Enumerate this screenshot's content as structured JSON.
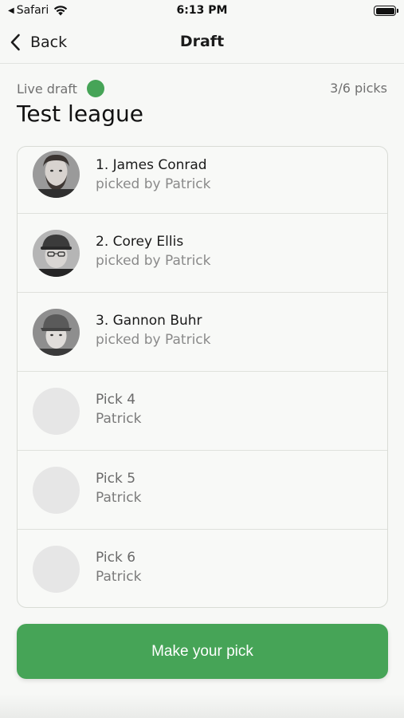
{
  "status_bar": {
    "back_app": "Safari",
    "time": "6:13 PM",
    "icons": [
      "back-triangle-icon",
      "wifi-icon",
      "battery-icon"
    ]
  },
  "nav": {
    "back_label": "Back",
    "title": "Draft"
  },
  "header": {
    "live_label": "Live draft",
    "live_color": "#46a457",
    "pick_count": "3/6 picks",
    "league_name": "Test league"
  },
  "picks": [
    {
      "name": "1. James Conrad",
      "sub": "picked by Patrick",
      "avatar": "player-photo"
    },
    {
      "name": "2. Corey Ellis",
      "sub": "picked by Patrick",
      "avatar": "player-photo"
    },
    {
      "name": "3. Gannon Buhr",
      "sub": "picked by Patrick",
      "avatar": "player-photo"
    },
    {
      "name": "Pick 4",
      "sub": "Patrick",
      "avatar": "empty"
    },
    {
      "name": "Pick 5",
      "sub": "Patrick",
      "avatar": "empty"
    },
    {
      "name": "Pick 6",
      "sub": "Patrick",
      "avatar": "empty"
    }
  ],
  "cta": {
    "label": "Make your pick",
    "color": "#46a457"
  }
}
